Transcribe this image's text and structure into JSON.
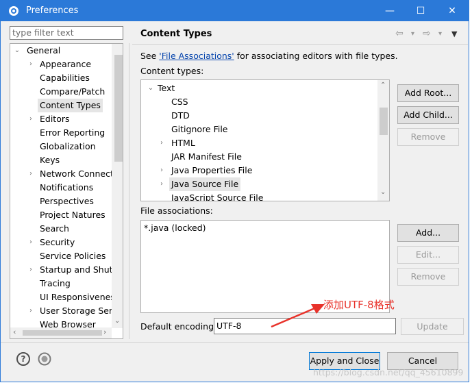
{
  "window": {
    "title": "Preferences",
    "minimize": "—",
    "maximize": "☐",
    "close": "✕"
  },
  "filter": {
    "placeholder": "type filter text"
  },
  "tree": {
    "root": "General",
    "items": [
      {
        "label": "Appearance",
        "expandable": true
      },
      {
        "label": "Capabilities",
        "expandable": false
      },
      {
        "label": "Compare/Patch",
        "expandable": false
      },
      {
        "label": "Content Types",
        "expandable": false,
        "selected": true
      },
      {
        "label": "Editors",
        "expandable": true
      },
      {
        "label": "Error Reporting",
        "expandable": false
      },
      {
        "label": "Globalization",
        "expandable": false
      },
      {
        "label": "Keys",
        "expandable": false
      },
      {
        "label": "Network Connectio",
        "expandable": true
      },
      {
        "label": "Notifications",
        "expandable": false
      },
      {
        "label": "Perspectives",
        "expandable": false
      },
      {
        "label": "Project Natures",
        "expandable": false
      },
      {
        "label": "Search",
        "expandable": false
      },
      {
        "label": "Security",
        "expandable": true
      },
      {
        "label": "Service Policies",
        "expandable": false
      },
      {
        "label": "Startup and Shutd",
        "expandable": true
      },
      {
        "label": "Tracing",
        "expandable": false
      },
      {
        "label": "UI Responsiveness",
        "expandable": false
      },
      {
        "label": "User Storage Serv",
        "expandable": true
      },
      {
        "label": "Web Browser",
        "expandable": false
      }
    ]
  },
  "page": {
    "title": "Content Types",
    "see_prefix": "See ",
    "see_link": "'File Associations'",
    "see_suffix": " for associating editors with file types.",
    "content_types_label": "Content types:",
    "file_assoc_label": "File associations:",
    "encoding_label": "Default encoding:",
    "encoding_value": "UTF-8"
  },
  "content_types": {
    "root": "Text",
    "items": [
      {
        "label": "CSS",
        "expandable": false
      },
      {
        "label": "DTD",
        "expandable": false
      },
      {
        "label": "Gitignore File",
        "expandable": false
      },
      {
        "label": "HTML",
        "expandable": true
      },
      {
        "label": "JAR Manifest File",
        "expandable": false
      },
      {
        "label": "Java Properties File",
        "expandable": true
      },
      {
        "label": "Java Source File",
        "expandable": true,
        "selected": true
      },
      {
        "label": "JavaScript Source File",
        "expandable": false
      }
    ]
  },
  "file_associations": [
    "*.java (locked)"
  ],
  "buttons": {
    "add_root": "Add Root...",
    "add_child": "Add Child...",
    "remove1": "Remove",
    "add": "Add...",
    "edit": "Edit...",
    "remove2": "Remove",
    "update": "Update",
    "apply_close": "Apply and Close",
    "cancel": "Cancel"
  },
  "annotation": "添加UTF-8格式",
  "watermark": "https://blog.csdn.net/qq_45610899",
  "colors": {
    "titlebar": "#2b79d8",
    "annotation": "#e8322a"
  }
}
